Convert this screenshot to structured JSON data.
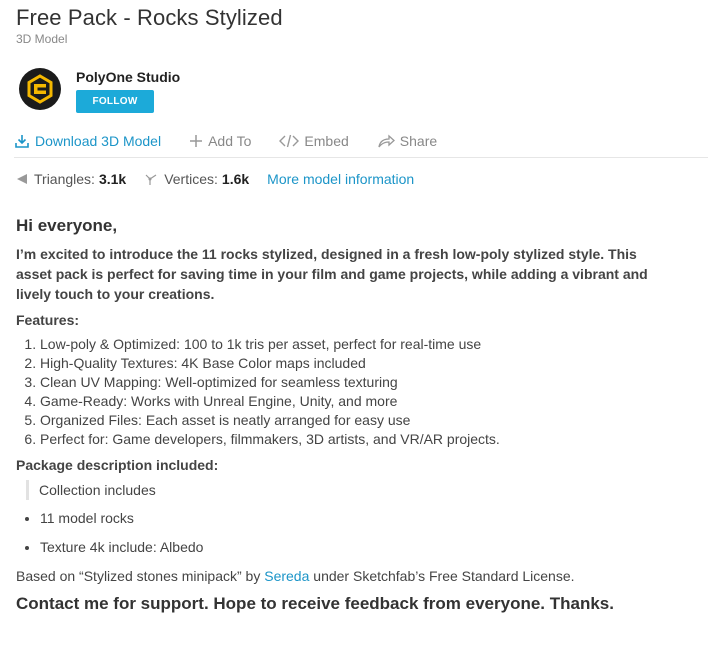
{
  "header": {
    "title": "Free Pack - Rocks Stylized",
    "subtitle": "3D Model"
  },
  "author": {
    "name": "PolyOne Studio",
    "follow_label": "FOLLOW",
    "avatar_bg": "#1b1b1b",
    "avatar_accent": "#f5b800"
  },
  "actions": {
    "download": "Download 3D Model",
    "add_to": "Add To",
    "embed": "Embed",
    "share": "Share"
  },
  "stats": {
    "triangles_label": "Triangles:",
    "triangles_value": "3.1k",
    "vertices_label": "Vertices:",
    "vertices_value": "1.6k",
    "more_info": "More model information"
  },
  "description": {
    "greeting": "Hi everyone,",
    "intro": "I’m excited to introduce the 11 rocks stylized, designed in a fresh low-poly stylized style. This asset pack is perfect for saving time in your film and game projects, while adding a vibrant and lively touch to your creations.",
    "features_heading": "Features:",
    "features": [
      "Low-poly & Optimized: 100 to 1k tris per asset, perfect for real-time use",
      "High-Quality Textures: 4K Base Color maps included",
      "Clean UV Mapping: Well-optimized for seamless texturing",
      "Game-Ready: Works with Unreal Engine, Unity, and more",
      "Organized Files: Each asset is neatly arranged for easy use",
      "Perfect for: Game developers, filmmakers, 3D artists, and VR/AR projects."
    ],
    "package_heading": "Package description included:",
    "collection_quote": "Collection includes",
    "package_items": [
      "11 model rocks",
      "Texture 4k include: Albedo"
    ],
    "license_prefix": "Based on “Stylized stones minipack” by ",
    "license_author": "Sereda",
    "license_suffix": " under Sketchfab’s Free Standard License.",
    "support": "Contact me for support. Hope to receive feedback from everyone. Thanks."
  },
  "colors": {
    "link": "#1c95c8",
    "follow_button": "#1caad9",
    "text": "#333333",
    "muted": "#888888"
  }
}
